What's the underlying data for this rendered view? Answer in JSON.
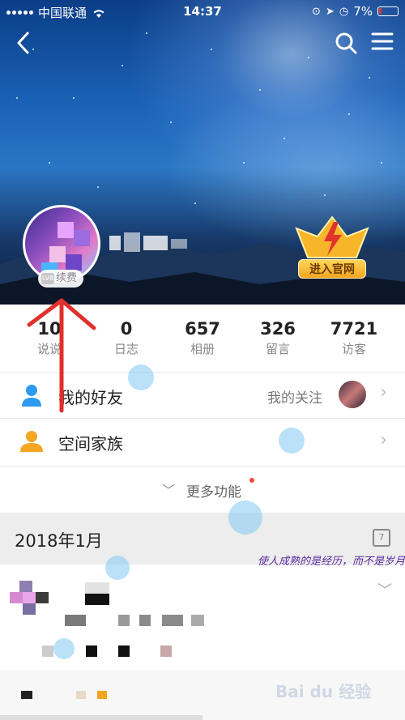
{
  "status_bar": {
    "carrier": "中国联通",
    "time": "14:37",
    "battery": "7%"
  },
  "profile": {
    "renew_label": "续费",
    "vip_tag": "LV8",
    "official_badge": "进入官网"
  },
  "stats": [
    {
      "value": "10",
      "label": "说说"
    },
    {
      "value": "0",
      "label": "日志"
    },
    {
      "value": "657",
      "label": "相册"
    },
    {
      "value": "326",
      "label": "留言"
    },
    {
      "value": "7721",
      "label": "访客"
    }
  ],
  "friends_row": {
    "title": "我的好友",
    "sub": "我的关注"
  },
  "family_row": {
    "title": "空间家族"
  },
  "more_label": "更多功能",
  "month_label": "2018年1月",
  "calendar_day": "7",
  "signature": "使人成熟的是经历，而不是岁月",
  "watermark": "Bai du 经验",
  "colors": {
    "accent": "#2f9bf0",
    "red_dot": "#f04a3f",
    "badge_gold": "#f3a51f"
  }
}
